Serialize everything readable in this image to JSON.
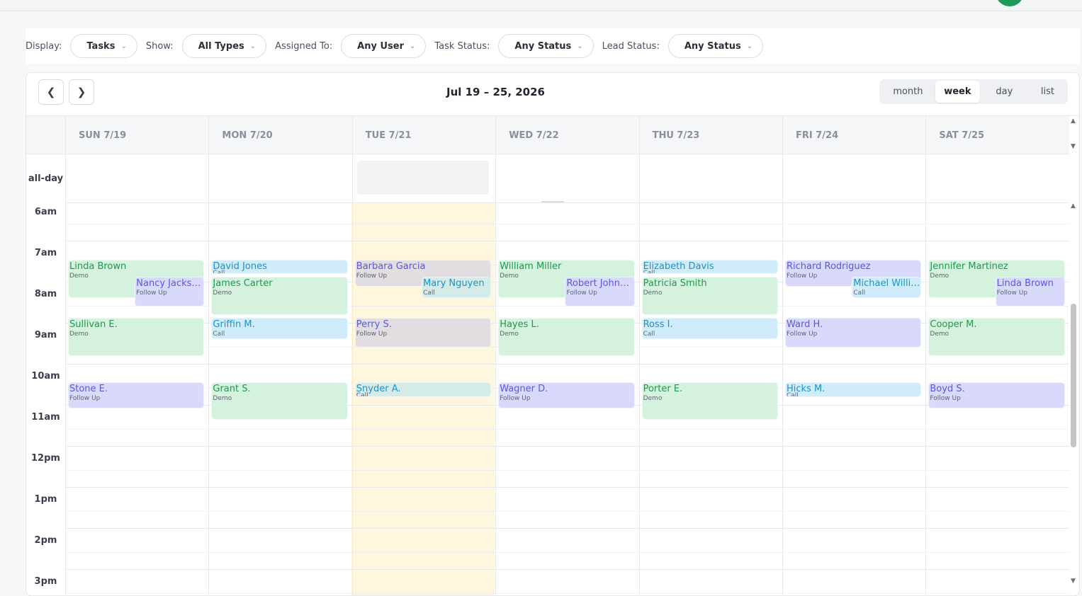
{
  "filters": [
    {
      "label": "Display:",
      "value": "Tasks"
    },
    {
      "label": "Show:",
      "value": "All Types"
    },
    {
      "label": "Assigned To:",
      "value": "Any User"
    },
    {
      "label": "Task Status:",
      "value": "Any Status"
    },
    {
      "label": "Lead Status:",
      "value": "Any Status"
    }
  ],
  "calendar": {
    "range": "Jul 19 – 25, 2026",
    "views": [
      "month",
      "week",
      "day",
      "list"
    ],
    "active_view": "week",
    "days": [
      "SUN 7/19",
      "MON 7/20",
      "TUE 7/21",
      "WED 7/22",
      "THU 7/23",
      "FRI 7/24",
      "SAT 7/25"
    ],
    "today_index": 2,
    "allday_label": "all-day",
    "times": [
      "6am",
      "7am",
      "8am",
      "9am",
      "10am",
      "11am",
      "12pm",
      "1pm",
      "2pm",
      "3pm"
    ]
  },
  "events": [
    {
      "day": 0,
      "start": 7.5,
      "end": 8.43,
      "title": "Linda Brown",
      "type": "Demo",
      "lane": 0,
      "lanes": 1
    },
    {
      "day": 0,
      "start": 7.92,
      "end": 8.63,
      "title": "Nancy Jacks…",
      "type": "Follow Up",
      "lane": 1,
      "lanes": 2
    },
    {
      "day": 0,
      "start": 8.92,
      "end": 9.85,
      "title": "Sullivan E.",
      "type": "Demo",
      "lane": 0,
      "lanes": 1
    },
    {
      "day": 0,
      "start": 10.48,
      "end": 11.12,
      "title": "Stone E.",
      "type": "Follow Up",
      "lane": 0,
      "lanes": 1
    },
    {
      "day": 1,
      "start": 7.5,
      "end": 7.85,
      "title": "David Jones",
      "type": "Call",
      "lane": 0,
      "lanes": 1
    },
    {
      "day": 1,
      "start": 7.92,
      "end": 8.85,
      "title": "James Carter",
      "type": "Demo",
      "lane": 0,
      "lanes": 1
    },
    {
      "day": 1,
      "start": 8.92,
      "end": 9.43,
      "title": "Griffin M.",
      "type": "Call",
      "lane": 0,
      "lanes": 1
    },
    {
      "day": 1,
      "start": 10.48,
      "end": 11.4,
      "title": "Grant S.",
      "type": "Demo",
      "lane": 0,
      "lanes": 1
    },
    {
      "day": 2,
      "start": 7.5,
      "end": 8.15,
      "title": "Barbara Garcia",
      "type": "Follow Up",
      "lane": 0,
      "lanes": 1
    },
    {
      "day": 2,
      "start": 7.92,
      "end": 8.43,
      "title": "Mary Nguyen",
      "type": "Call",
      "lane": 1,
      "lanes": 2
    },
    {
      "day": 2,
      "start": 8.92,
      "end": 9.63,
      "title": "Perry S.",
      "type": "Follow Up",
      "lane": 0,
      "lanes": 1
    },
    {
      "day": 2,
      "start": 10.48,
      "end": 10.85,
      "title": "Snyder A.",
      "type": "Call",
      "lane": 0,
      "lanes": 1
    },
    {
      "day": 3,
      "start": 7.5,
      "end": 8.43,
      "title": "William Miller",
      "type": "Demo",
      "lane": 0,
      "lanes": 1
    },
    {
      "day": 3,
      "start": 7.92,
      "end": 8.63,
      "title": "Robert John…",
      "type": "Follow Up",
      "lane": 1,
      "lanes": 2
    },
    {
      "day": 3,
      "start": 8.92,
      "end": 9.85,
      "title": "Hayes L.",
      "type": "Demo",
      "lane": 0,
      "lanes": 1
    },
    {
      "day": 3,
      "start": 10.48,
      "end": 11.12,
      "title": "Wagner D.",
      "type": "Follow Up",
      "lane": 0,
      "lanes": 1
    },
    {
      "day": 4,
      "start": 7.5,
      "end": 7.85,
      "title": "Elizabeth Davis",
      "type": "Call",
      "lane": 0,
      "lanes": 1
    },
    {
      "day": 4,
      "start": 7.92,
      "end": 8.85,
      "title": "Patricia Smith",
      "type": "Demo",
      "lane": 0,
      "lanes": 1
    },
    {
      "day": 4,
      "start": 8.92,
      "end": 9.43,
      "title": "Ross I.",
      "type": "Call",
      "lane": 0,
      "lanes": 1
    },
    {
      "day": 4,
      "start": 10.48,
      "end": 11.4,
      "title": "Porter E.",
      "type": "Demo",
      "lane": 0,
      "lanes": 1
    },
    {
      "day": 5,
      "start": 7.5,
      "end": 8.15,
      "title": "Richard Rodriguez",
      "type": "Follow Up",
      "lane": 0,
      "lanes": 1
    },
    {
      "day": 5,
      "start": 7.92,
      "end": 8.43,
      "title": "Michael Willi…",
      "type": "Call",
      "lane": 1,
      "lanes": 2
    },
    {
      "day": 5,
      "start": 8.92,
      "end": 9.63,
      "title": "Ward H.",
      "type": "Follow Up",
      "lane": 0,
      "lanes": 1
    },
    {
      "day": 5,
      "start": 10.48,
      "end": 10.85,
      "title": "Hicks M.",
      "type": "Call",
      "lane": 0,
      "lanes": 1
    },
    {
      "day": 6,
      "start": 7.5,
      "end": 8.43,
      "title": "Jennifer Martinez",
      "type": "Demo",
      "lane": 0,
      "lanes": 1
    },
    {
      "day": 6,
      "start": 7.92,
      "end": 8.63,
      "title": "Linda Brown",
      "type": "Follow Up",
      "lane": 1,
      "lanes": 2
    },
    {
      "day": 6,
      "start": 8.92,
      "end": 9.85,
      "title": "Cooper M.",
      "type": "Demo",
      "lane": 0,
      "lanes": 1
    },
    {
      "day": 6,
      "start": 10.48,
      "end": 11.12,
      "title": "Boyd S.",
      "type": "Follow Up",
      "lane": 0,
      "lanes": 1
    }
  ]
}
